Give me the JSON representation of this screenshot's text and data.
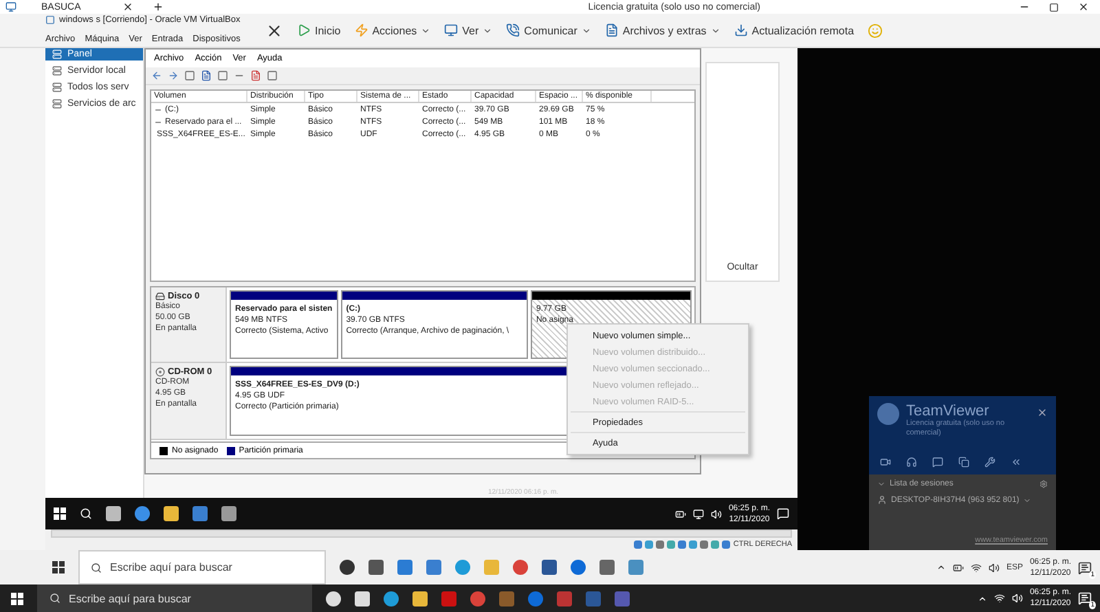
{
  "remote_tab_bar": {
    "tab": "BASUCA",
    "license": "Licencia gratuita (solo uso no comercial)"
  },
  "virtualbox": {
    "title": "windows s [Corriendo] - Oracle VM VirtualBox",
    "menu": [
      "Archivo",
      "Máquina",
      "Ver",
      "Entrada",
      "Dispositivos"
    ],
    "host_key": "CTRL DERECHA"
  },
  "teamviewer_toolbar": [
    {
      "label": "Inicio",
      "kind": "button"
    },
    {
      "label": "Acciones",
      "kind": "dropdown"
    },
    {
      "label": "Ver",
      "kind": "dropdown"
    },
    {
      "label": "Comunicar",
      "kind": "dropdown"
    },
    {
      "label": "Archivos y extras",
      "kind": "dropdown"
    },
    {
      "label": "Actualización remota",
      "kind": "button"
    }
  ],
  "server_manager": {
    "sidebar": [
      {
        "label": "Panel",
        "selected": true
      },
      {
        "label": "Servidor local",
        "selected": false
      },
      {
        "label": "Todos los serv",
        "selected": false
      },
      {
        "label": "Servicios de arc",
        "selected": false
      }
    ],
    "hide_label": "Ocultar",
    "desktop_caption": "12/11/2020 06:16 p. m."
  },
  "disk_management": {
    "menu": [
      "Archivo",
      "Acción",
      "Ver",
      "Ayuda"
    ],
    "table": {
      "columns": [
        "Volumen",
        "Distribución",
        "Tipo",
        "Sistema de ...",
        "Estado",
        "Capacidad",
        "Espacio ...",
        "% disponible"
      ],
      "rows": [
        {
          "kind": "disk",
          "cells": [
            "(C:)",
            "Simple",
            "Básico",
            "NTFS",
            "Correcto (...",
            "39.70 GB",
            "29.69 GB",
            "75 %"
          ]
        },
        {
          "kind": "disk",
          "cells": [
            "Reservado para el ...",
            "Simple",
            "Básico",
            "NTFS",
            "Correcto (...",
            "549 MB",
            "101 MB",
            "18 %"
          ]
        },
        {
          "kind": "cd",
          "cells": [
            "SSS_X64FREE_ES-E...",
            "Simple",
            "Básico",
            "UDF",
            "Correcto (...",
            "4.95 GB",
            "0 MB",
            "0 %"
          ]
        }
      ]
    },
    "disks": [
      {
        "kind": "disk",
        "name": "Disco 0",
        "lines": [
          "Básico",
          "50.00 GB",
          "En pantalla"
        ],
        "partitions": [
          {
            "kind": "primary",
            "title": "Reservado para el sisten",
            "lines": [
              "549 MB NTFS",
              "Correcto (Sistema, Activo"
            ]
          },
          {
            "kind": "primary",
            "title": "(C:)",
            "lines": [
              "39.70 GB NTFS",
              "Correcto (Arranque, Archivo de paginación, \\"
            ]
          },
          {
            "kind": "unallocated",
            "title": "9.77 GB",
            "lines": [
              "No asigna"
            ]
          }
        ]
      },
      {
        "kind": "cd",
        "name": "CD-ROM 0",
        "lines": [
          "CD-ROM",
          "4.95 GB",
          "En pantalla"
        ],
        "partitions": [
          {
            "kind": "primary",
            "title": "SSS_X64FREE_ES-ES_DV9  (D:)",
            "lines": [
              "4.95 GB UDF",
              "Correcto (Partición primaria)"
            ]
          }
        ]
      }
    ],
    "legend": [
      {
        "label": "No asignado",
        "color": "#000000"
      },
      {
        "label": "Partición primaria",
        "color": "#00007f"
      }
    ]
  },
  "context_menu": [
    {
      "kind": "item",
      "label": "Nuevo volumen simple...",
      "disabled": false
    },
    {
      "kind": "item",
      "label": "Nuevo volumen distribuido...",
      "disabled": true
    },
    {
      "kind": "item",
      "label": "Nuevo volumen seccionado...",
      "disabled": true
    },
    {
      "kind": "item",
      "label": "Nuevo volumen reflejado...",
      "disabled": true
    },
    {
      "kind": "item",
      "label": "Nuevo volumen RAID-5...",
      "disabled": true
    },
    {
      "kind": "separator"
    },
    {
      "kind": "item",
      "label": "Propiedades",
      "disabled": false
    },
    {
      "kind": "separator"
    },
    {
      "kind": "item",
      "label": "Ayuda",
      "disabled": false
    }
  ],
  "vm_taskbar": {
    "time": "06:25 p. m.",
    "date": "12/11/2020"
  },
  "host_taskbar": {
    "search_placeholder": "Escribe aquí para buscar",
    "language": "ESP",
    "time": "06:25 p. m.",
    "date": "12/11/2020",
    "notifications": "1"
  },
  "local_taskbar": {
    "search_placeholder": "Escribe aquí para buscar",
    "time": "06:25 p. m.",
    "date": "12/11/2020",
    "notifications": "1"
  },
  "teamviewer_panel": {
    "title": "TeamViewer",
    "license": "Licencia gratuita (solo uso no comercial)",
    "sessions_header": "Lista de sesiones",
    "session": "DESKTOP-8IH37H4 (963 952 801)",
    "link": "www.teamviewer.com"
  }
}
